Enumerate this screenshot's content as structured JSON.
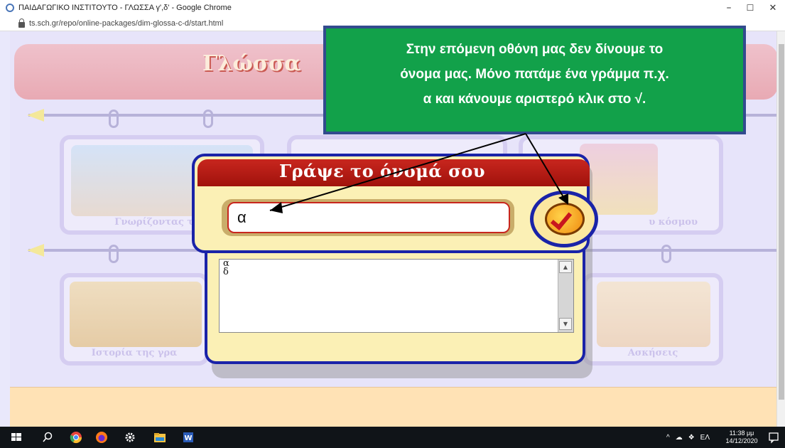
{
  "browser": {
    "window_title": "ΠΑΙΔΑΓΩΓΙΚΟ ΙΝΣΤΙΤΟΥΤΟ - ΓΛΩΣΣΑ γ',δ' - Google Chrome",
    "url": "ts.sch.gr/repo/online-packages/dim-glossa-c-d/start.html",
    "minimize": "–",
    "maximize": "☐",
    "close": "✕"
  },
  "app": {
    "banner_title": "Γλώσσα",
    "cards": [
      {
        "caption": "Γνωρίζοντας τη χ"
      },
      {
        "caption": "υ κόσμου"
      },
      {
        "caption": "Ιστορία της γρα"
      },
      {
        "caption": "Ασκήσεις"
      }
    ]
  },
  "dialog": {
    "title": "Γράψε το όνομά σου",
    "name_value": "α",
    "list_items": [
      "α",
      "δ"
    ],
    "scroll_up": "▲",
    "scroll_down": "▼"
  },
  "callout": {
    "line1": "Στην επόμενη οθόνη μας δεν δίνουμε το",
    "line2": "όνομα μας. Μόνο πατάμε ένα γράμμα π.χ.",
    "line3": "α και  κάνουμε αριστερό κλικ στο √."
  },
  "taskbar": {
    "language": "ΕΛ",
    "time": "11:38 μμ",
    "date": "14/12/2020"
  },
  "colors": {
    "callout_bg": "#12a14a",
    "dialog_border": "#1a23a8",
    "dialog_header": "#c8261e"
  }
}
